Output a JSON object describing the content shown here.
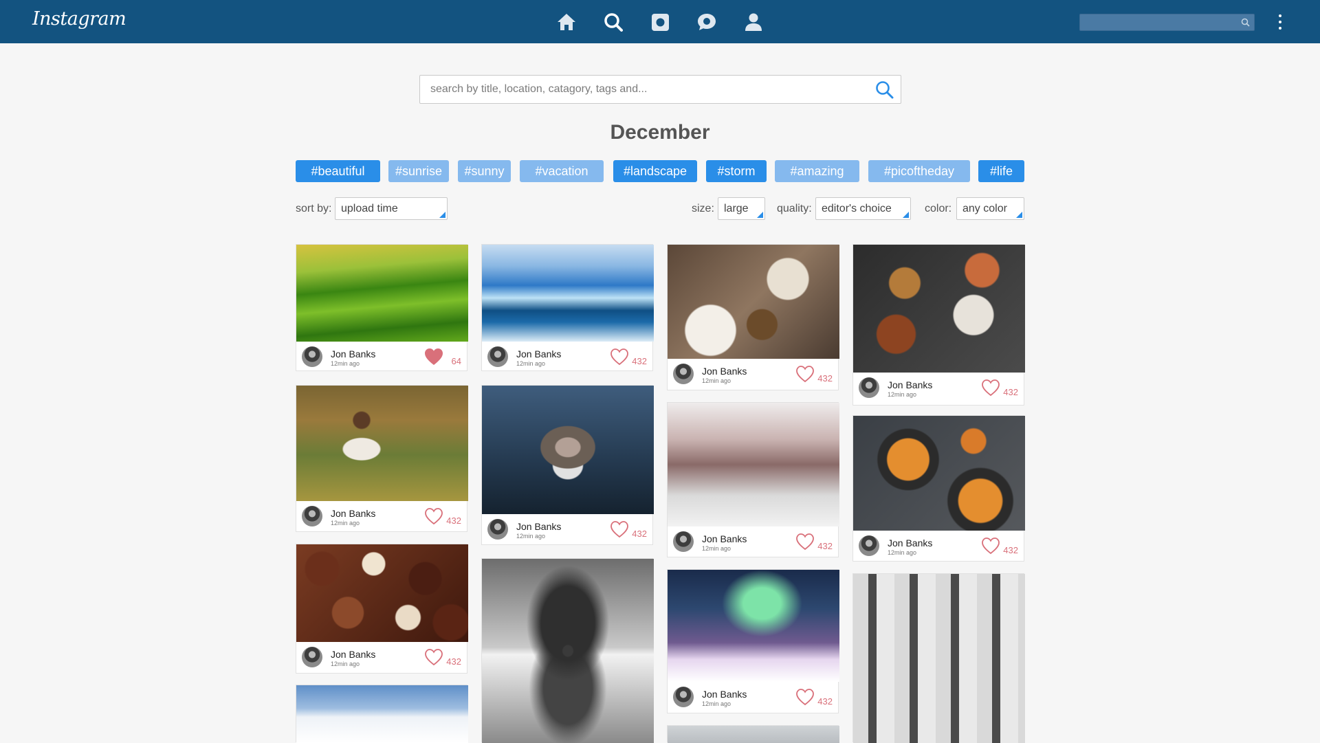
{
  "app": {
    "title": "Instagram"
  },
  "topbar": {
    "nav": [
      {
        "name": "home-icon"
      },
      {
        "name": "search-icon"
      },
      {
        "name": "camera-icon"
      },
      {
        "name": "chat-icon"
      },
      {
        "name": "profile-icon"
      }
    ],
    "search_placeholder": "",
    "menu_icon": "kebab-menu-icon"
  },
  "search": {
    "placeholder": "search by title, location, catagory, tags and..."
  },
  "page": {
    "title": "December"
  },
  "tags": [
    "#beautiful",
    "#sunrise",
    "#sunny",
    "#vacation",
    "#landscape",
    "#storm",
    "#amazing",
    "#picoftheday",
    "#life"
  ],
  "filters": {
    "sort_label": "sort by:",
    "sort_value": "upload time",
    "size_label": "size:",
    "size_value": "large",
    "quality_label": "quality:",
    "quality_value": "editor's choice",
    "color_label": "color:",
    "color_value": "any color"
  },
  "cards": [
    {
      "author": "Jon Banks",
      "time": "12min ago",
      "likes": "64",
      "liked": true
    },
    {
      "author": "Jon Banks",
      "time": "12min ago",
      "likes": "432",
      "liked": false
    },
    {
      "author": "Jon Banks",
      "time": "12min ago",
      "likes": "432",
      "liked": false
    },
    {
      "author": "Jon Banks",
      "time": "12min ago",
      "likes": "432",
      "liked": false
    },
    {
      "author": "Jon Banks",
      "time": "12min ago",
      "likes": "432",
      "liked": false
    },
    {
      "author": "Jon Banks",
      "time": "12min ago",
      "likes": "432",
      "liked": false
    },
    {
      "author": "Jon Banks",
      "time": "12min ago",
      "likes": "432",
      "liked": false
    },
    {
      "author": "Jon Banks",
      "time": "12min ago",
      "likes": "432",
      "liked": false
    },
    {
      "author": "Jon Banks",
      "time": "12min ago",
      "likes": "432",
      "liked": false
    },
    {
      "author": "Jon Banks",
      "time": "12min ago",
      "likes": "432",
      "liked": false
    }
  ],
  "colors": {
    "topbar": "#135380",
    "tag_dark": "#2a8ee8",
    "tag_light": "#85b9ee",
    "like": "#d9707a"
  }
}
